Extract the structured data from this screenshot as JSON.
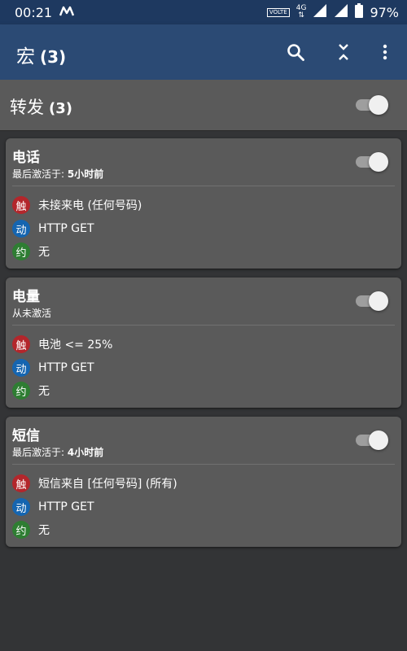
{
  "status": {
    "time": "00:21",
    "volte": "VOLTE",
    "network": "4G",
    "battery": "97%"
  },
  "appbar": {
    "title": "宏",
    "count": "(3)"
  },
  "group": {
    "title": "转发",
    "count": "(3)"
  },
  "colors": {
    "trigger": "#b3262b",
    "action": "#1565b0",
    "constraint": "#2e7d32",
    "appbar": "#2b4a74",
    "statusbar": "#1e3960"
  },
  "macros": [
    {
      "title": "电话",
      "subtitle_prefix": "最后激活于: ",
      "subtitle_value": "5小时前",
      "rows": [
        {
          "badge": "触",
          "text": "未接来电 (任何号码)"
        },
        {
          "badge": "动",
          "text": "HTTP GET"
        },
        {
          "badge": "约",
          "text": "无"
        }
      ]
    },
    {
      "title": "电量",
      "subtitle_prefix": "从未激活",
      "subtitle_value": "",
      "rows": [
        {
          "badge": "触",
          "text": "电池 <= 25%"
        },
        {
          "badge": "动",
          "text": "HTTP GET"
        },
        {
          "badge": "约",
          "text": "无"
        }
      ]
    },
    {
      "title": "短信",
      "subtitle_prefix": "最后激活于: ",
      "subtitle_value": "4小时前",
      "rows": [
        {
          "badge": "触",
          "text": "短信来自 [任何号码] (所有)"
        },
        {
          "badge": "动",
          "text": "HTTP GET"
        },
        {
          "badge": "约",
          "text": "无"
        }
      ]
    }
  ]
}
